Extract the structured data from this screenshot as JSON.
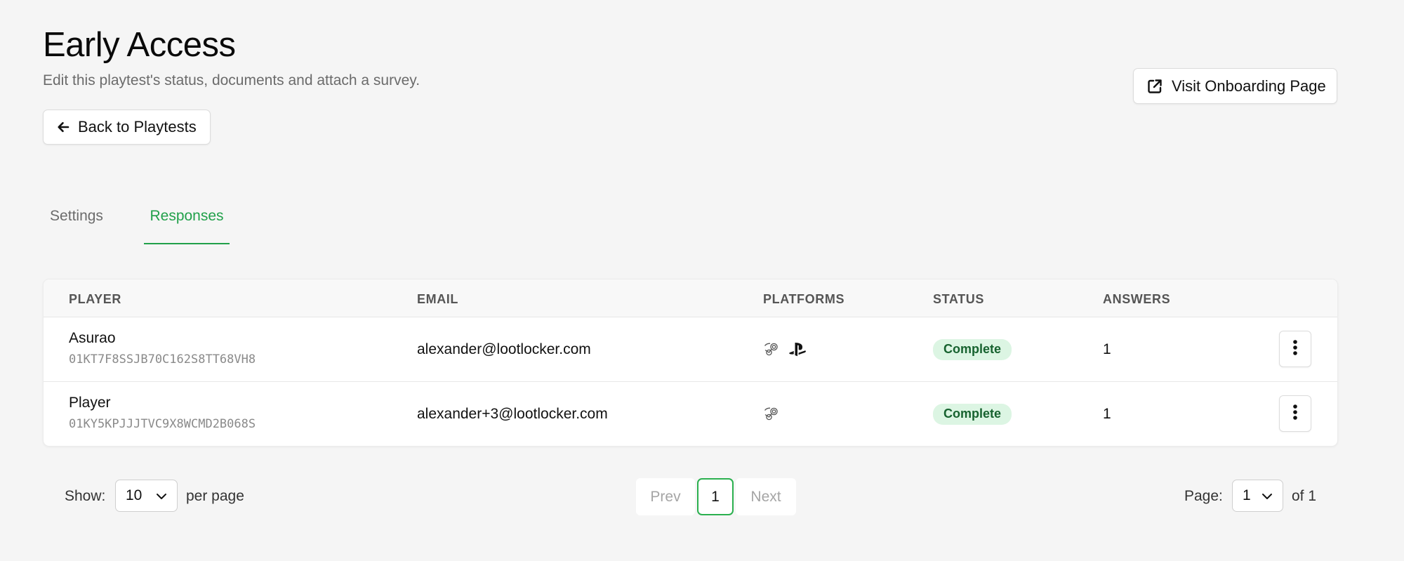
{
  "header": {
    "title": "Early Access",
    "subtitle": "Edit this playtest's status, documents and attach a survey.",
    "back_button": {
      "label": "Back to Playtests",
      "icon": "arrow-left-icon"
    },
    "visit_button": {
      "label": "Visit Onboarding Page",
      "icon": "external-link-icon"
    }
  },
  "tabs": [
    {
      "label": "Settings",
      "active": false
    },
    {
      "label": "Responses",
      "active": true
    }
  ],
  "table": {
    "columns": [
      "PLAYER",
      "EMAIL",
      "PLATFORMS",
      "STATUS",
      "ANSWERS"
    ],
    "rows": [
      {
        "player_name": "Asurao",
        "player_id": "01KT7F8SSJB70C162S8TT68VH8",
        "email": "alexander@lootlocker.com",
        "platforms": [
          "steam-icon",
          "playstation-icon"
        ],
        "status": "Complete",
        "answers": "1"
      },
      {
        "player_name": "Player",
        "player_id": "01KY5KPJJJTVC9X8WCMD2B068S",
        "email": "alexander+3@lootlocker.com",
        "platforms": [
          "steam-icon"
        ],
        "status": "Complete",
        "answers": "1"
      }
    ]
  },
  "pagination": {
    "show_label": "Show:",
    "per_page_value": "10",
    "per_page_label": "per page",
    "prev_label": "Prev",
    "current_page": "1",
    "next_label": "Next",
    "page_label": "Page:",
    "page_value": "1",
    "of_label": "of 1"
  },
  "colors": {
    "accent": "#21a04a",
    "status_bg": "#dcf5e3",
    "status_text": "#17622f",
    "background": "#f5f5f5"
  }
}
